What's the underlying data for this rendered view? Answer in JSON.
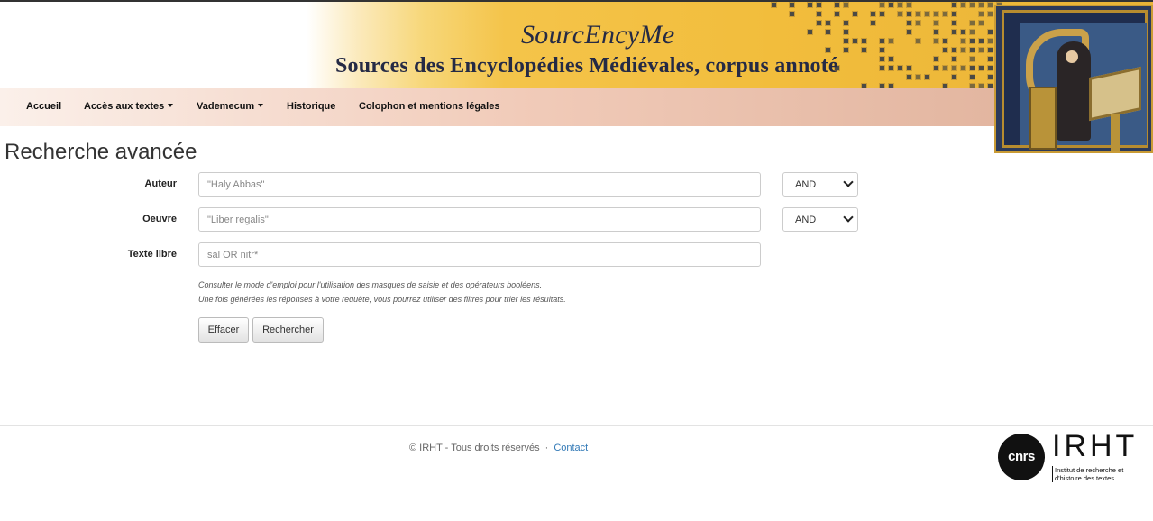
{
  "header": {
    "title": "SourcEncyMe",
    "subtitle": "Sources des Encyclopédies Médiévales, corpus annoté"
  },
  "nav": {
    "items": [
      {
        "label": "Accueil",
        "dropdown": false
      },
      {
        "label": "Accès aux textes",
        "dropdown": true
      },
      {
        "label": "Vademecum",
        "dropdown": true
      },
      {
        "label": "Historique",
        "dropdown": false
      },
      {
        "label": "Colophon et mentions légales",
        "dropdown": false
      }
    ]
  },
  "page": {
    "title": "Recherche avancée"
  },
  "form": {
    "author": {
      "label": "Auteur",
      "placeholder": "\"Haly Abbas\"",
      "operator": "AND"
    },
    "work": {
      "label": "Oeuvre",
      "placeholder": "\"Liber regalis\"",
      "operator": "AND"
    },
    "free_text": {
      "label": "Texte libre",
      "placeholder": "sal OR nitr*"
    },
    "help_line1": "Consulter le mode d'emploi pour l'utilisation des masques de saisie et des opérateurs booléens.",
    "help_line2": "Une fois générées les réponses à votre requête, vous pourrez utiliser des filtres pour trier les résultats.",
    "clear_label": "Effacer",
    "search_label": "Rechercher"
  },
  "footer": {
    "copyright": "© IRHT - Tous droits réservés",
    "separator": "·",
    "contact": "Contact",
    "logo_cnrs": "cnrs",
    "logo_irht": "IRHT",
    "logo_irht_sub": "Institut de recherche et d'histoire des textes"
  },
  "colors": {
    "banner_gold": "#f2bd3c",
    "navbar_peach": "#deaf98",
    "title_navy": "#252a45",
    "link_blue": "#337ab7"
  }
}
